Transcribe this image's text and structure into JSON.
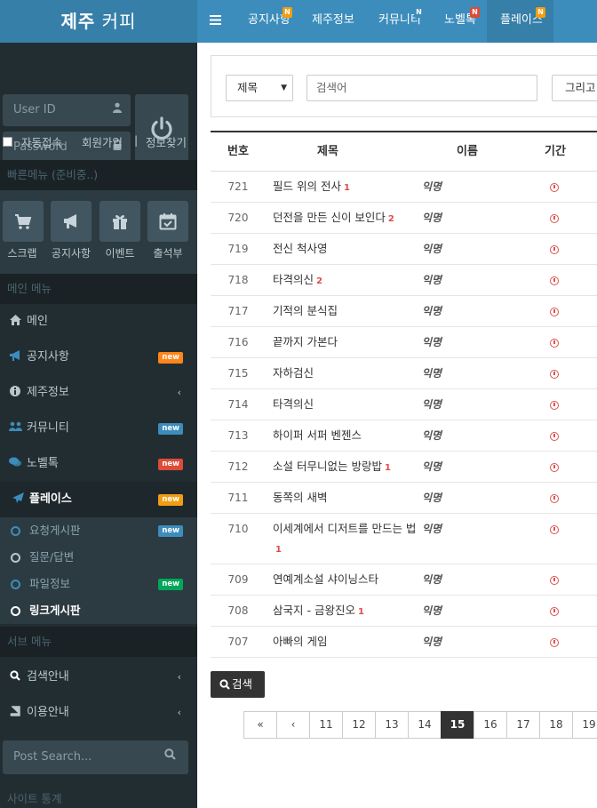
{
  "brand": {
    "bold": "제주",
    "rest": "커피"
  },
  "login": {
    "user_placeholder": "User ID",
    "password_placeholder": "Password",
    "auto_login": "자동접속",
    "join": "회원가입",
    "separator": "|",
    "find_info": "정보찾기"
  },
  "quick_menu": {
    "header": "빠른메뉴 (준비중..)",
    "items": [
      {
        "label": "스크랩",
        "icon": "cart-icon"
      },
      {
        "label": "공지사항",
        "icon": "bullhorn-icon"
      },
      {
        "label": "이벤트",
        "icon": "gift-icon"
      },
      {
        "label": "출석부",
        "icon": "calendar-check-icon"
      }
    ]
  },
  "main_menu": {
    "header": "메인 메뉴",
    "items": [
      {
        "label": "메인",
        "icon": "home-icon"
      },
      {
        "label": "공지사항",
        "icon": "bullhorn-icon",
        "badge": "new",
        "badge_color": "#ff851b"
      },
      {
        "label": "제주정보",
        "icon": "info-circle-icon",
        "chevron": "‹"
      },
      {
        "label": "커뮤니티",
        "icon": "users-icon",
        "badge": "new",
        "badge_color": "#3c8dbc"
      },
      {
        "label": "노벨톡",
        "icon": "comments-icon",
        "badge": "new",
        "badge_color": "#dd4b39"
      },
      {
        "label": "플레이스",
        "icon": "paper-plane-icon",
        "badge": "new",
        "badge_color": "#f39c12"
      }
    ],
    "sub_items": [
      {
        "label": "요청게시판",
        "badge": "new",
        "badge_color": "#3c8dbc"
      },
      {
        "label": "질문/답변"
      },
      {
        "label": "파일정보",
        "badge": "new",
        "badge_color": "#00a65a"
      },
      {
        "label": "링크게시판"
      }
    ]
  },
  "sub_menu": {
    "header": "서브 메뉴",
    "items": [
      {
        "label": "검색안내",
        "icon": "search-icon",
        "chevron": "‹"
      },
      {
        "label": "이용안내",
        "icon": "book-icon",
        "chevron": "‹"
      }
    ]
  },
  "post_search_placeholder": "Post Search...",
  "site_stats_header": "사이트 통계",
  "topnav": [
    {
      "label": "공지사항",
      "badge": "N",
      "badge_color": "#f39c12"
    },
    {
      "label": "제주정보"
    },
    {
      "label": "커뮤니티",
      "badge": "N",
      "badge_color": "#3c8dbc"
    },
    {
      "label": "노벨톡",
      "badge": "N",
      "badge_color": "#dd4b39"
    },
    {
      "label": "플레이스",
      "badge": "N",
      "badge_color": "#f39c12",
      "active": true
    }
  ],
  "search": {
    "field_select": "제목",
    "placeholder": "검색어",
    "operator_select": "그리고"
  },
  "table": {
    "headers": {
      "no": "번호",
      "title": "제목",
      "name": "이름",
      "term": "기간"
    },
    "rows": [
      {
        "no": "721",
        "title": "필드 위의 전사",
        "count": "1",
        "name": "익명"
      },
      {
        "no": "720",
        "title": "던전을 만든 신이 보인다",
        "count": "2",
        "name": "익명"
      },
      {
        "no": "719",
        "title": "전신 척사영",
        "count": "",
        "name": "익명"
      },
      {
        "no": "718",
        "title": "타격의신",
        "count": "2",
        "name": "익명"
      },
      {
        "no": "717",
        "title": "기적의 분식집",
        "count": "",
        "name": "익명"
      },
      {
        "no": "716",
        "title": "끝까지 가본다",
        "count": "",
        "name": "익명"
      },
      {
        "no": "715",
        "title": "자하검신",
        "count": "",
        "name": "익명"
      },
      {
        "no": "714",
        "title": "타격의신",
        "count": "",
        "name": "익명"
      },
      {
        "no": "713",
        "title": "하이퍼 서퍼 벤젠스",
        "count": "",
        "name": "익명"
      },
      {
        "no": "712",
        "title": "소설 터무니없는 방랑밥",
        "count": "1",
        "name": "익명"
      },
      {
        "no": "711",
        "title": "동쪽의 새벽",
        "count": "",
        "name": "익명"
      },
      {
        "no": "710",
        "title": "이세계에서 디저트를 만드는 법",
        "count": "1",
        "name": "익명"
      },
      {
        "no": "709",
        "title": "연예계소설 샤이닝스타",
        "count": "",
        "name": "익명"
      },
      {
        "no": "708",
        "title": "삼국지 - 금왕진오",
        "count": "1",
        "name": "익명"
      },
      {
        "no": "707",
        "title": "아빠의 게임",
        "count": "",
        "name": "익명"
      }
    ]
  },
  "search_button": "검색",
  "pagination": {
    "first": "«",
    "prev": "‹",
    "pages": [
      "11",
      "12",
      "13",
      "14",
      "15",
      "16",
      "17",
      "18",
      "19"
    ],
    "current": "15"
  }
}
